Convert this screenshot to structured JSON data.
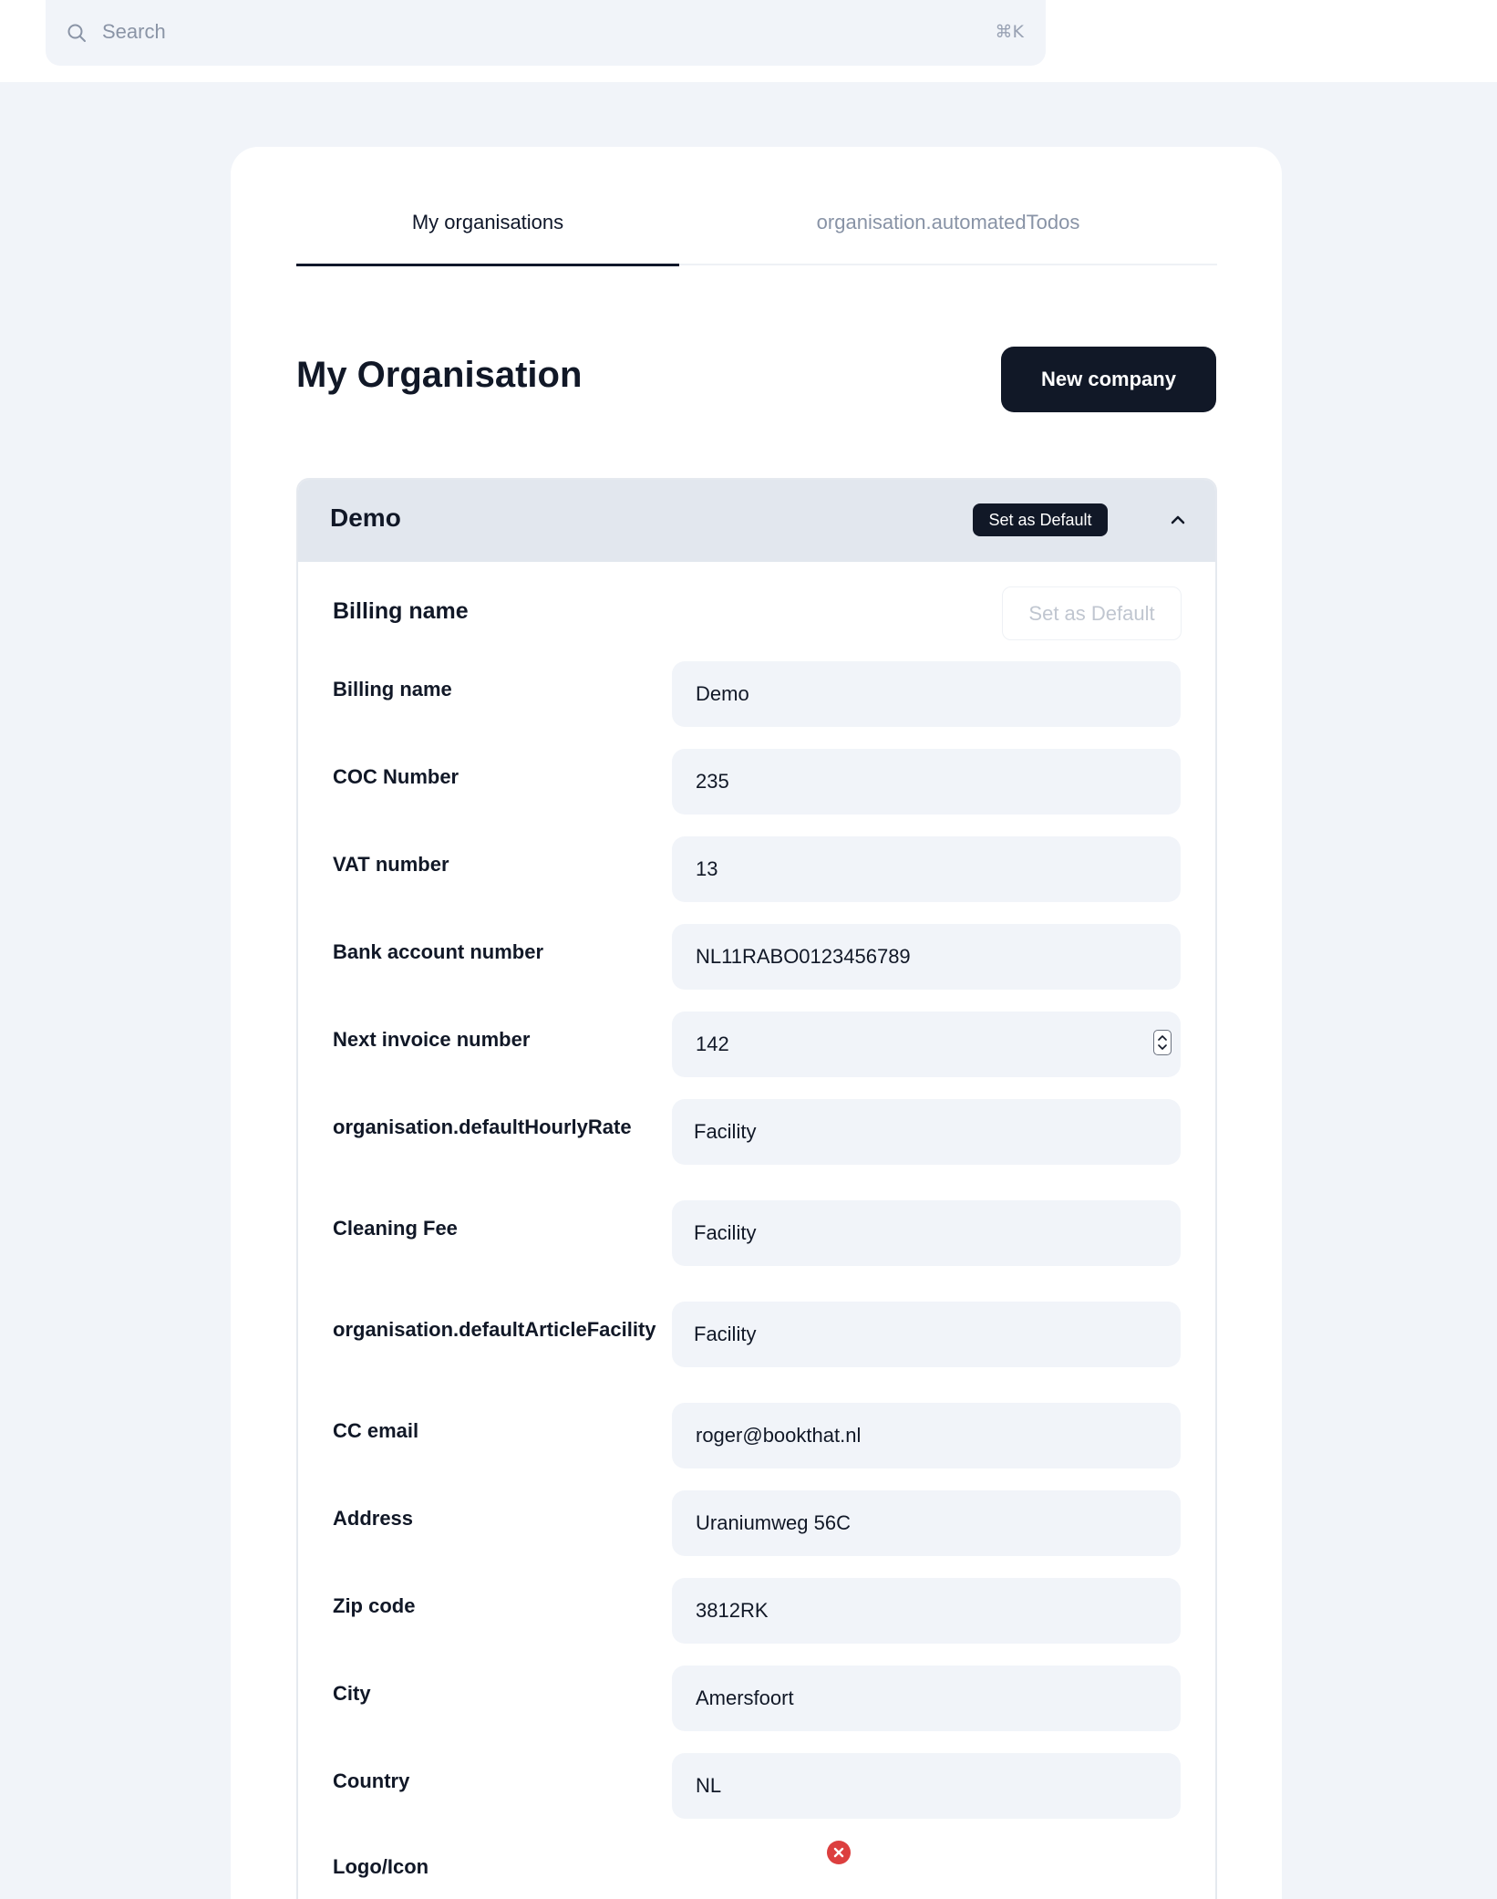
{
  "search": {
    "placeholder": "Search",
    "shortcut": "⌘K"
  },
  "tabs": [
    {
      "label": "My organisations",
      "active": true
    },
    {
      "label": "organisation.automatedTodos",
      "active": false
    }
  ],
  "page": {
    "title": "My Organisation",
    "new_button": "New company"
  },
  "organisation": {
    "name": "Demo",
    "default_badge": "Set as Default",
    "section_title": "Billing name",
    "section_default_button": "Set as Default",
    "fields": [
      {
        "label": "Billing name",
        "value": "Demo"
      },
      {
        "label": "COC Number",
        "value": "235"
      },
      {
        "label": "VAT number",
        "value": "13"
      },
      {
        "label": "Bank account number",
        "value": "NL11RABO0123456789"
      },
      {
        "label": "Next invoice number",
        "value": "142"
      },
      {
        "label": "organisation.defaultHourlyRate",
        "value": "Facility"
      },
      {
        "label": "Cleaning Fee",
        "value": "Facility"
      },
      {
        "label": "organisation.defaultArticleFacility",
        "value": "Facility"
      },
      {
        "label": "CC email",
        "value": "roger@bookthat.nl"
      },
      {
        "label": "Address",
        "value": "Uraniumweg 56C"
      },
      {
        "label": "Zip code",
        "value": "3812RK"
      },
      {
        "label": "City",
        "value": "Amersfoort"
      },
      {
        "label": "Country",
        "value": "NL"
      }
    ],
    "cut_off_label": "Logo/Icon"
  },
  "colors": {
    "primary": "#111827",
    "background": "#f1f4f9",
    "error": "#dc3f3f"
  }
}
